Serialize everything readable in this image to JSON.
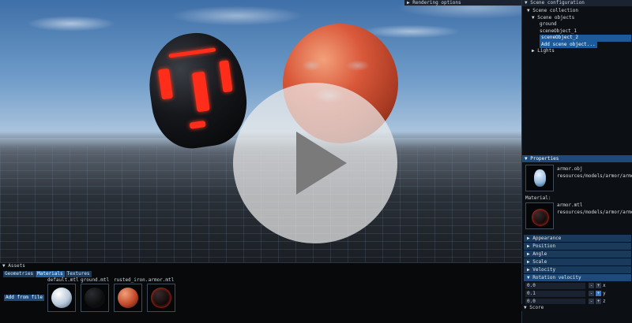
{
  "viewport": {
    "render_options_label": "▶ Rendering options"
  },
  "play_button": {
    "icon": "play-icon"
  },
  "scene_panel": {
    "title": "▼ Scene configuration",
    "collection": "▼ Scene collection",
    "objects": "▼ Scene objects",
    "items": [
      "ground",
      "sceneObject_1",
      "sceneObject_2"
    ],
    "add_button": "Add scene object...",
    "lights": "▶ Lights"
  },
  "properties": {
    "title": "▼ Properties",
    "model_name": "armor.obj",
    "model_path": "resources/models/armor/armor.obj",
    "material_label": "Material:",
    "material_name": "armor.mtl",
    "material_path": "resources/models/armor/armor.mtl",
    "sections": [
      "▶ Appearance",
      "▶ Position",
      "▶ Angle",
      "▶ Scale",
      "▶ Velocity"
    ],
    "rotation_velocity": "▼ Rotation velocity",
    "velocity_rows": [
      {
        "value": "0.0",
        "axis": "x"
      },
      {
        "value": "0.1",
        "axis": "y"
      },
      {
        "value": "0.0",
        "axis": "z"
      }
    ],
    "minus": "-",
    "plus": "+"
  },
  "score": {
    "title": "▼ Score"
  },
  "assets": {
    "title": "▼ Assets",
    "tabs": [
      "Geometries",
      "Materials",
      "Textures"
    ],
    "add_from_file": "Add from file",
    "items": [
      "default.mtl",
      "ground.mtl",
      "rusted_iron.",
      "armor.mtl"
    ]
  },
  "colors": {
    "accent": "#1d5a99",
    "helmet_glow": "#ff2d1a",
    "sphere": "#d9583a"
  }
}
